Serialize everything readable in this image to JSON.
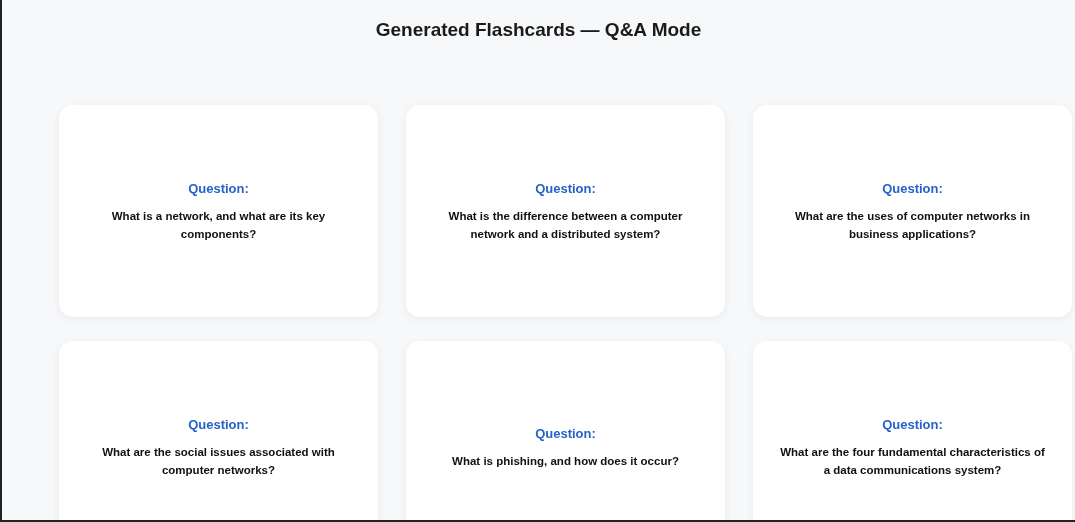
{
  "title": "Generated Flashcards — Q&A Mode",
  "cards": [
    {
      "label": "Question:",
      "text": "What is a network, and what are its key components?"
    },
    {
      "label": "Question:",
      "text": "What is the difference between a computer network and a distributed system?"
    },
    {
      "label": "Question:",
      "text": "What are the uses of computer networks in business applications?"
    },
    {
      "label": "Question:",
      "text": "What are the social issues associated with computer networks?"
    },
    {
      "label": "Question:",
      "text": "What is phishing, and how does it occur?"
    },
    {
      "label": "Question:",
      "text": "What are the four fundamental characteristics of a data communications system?"
    }
  ]
}
